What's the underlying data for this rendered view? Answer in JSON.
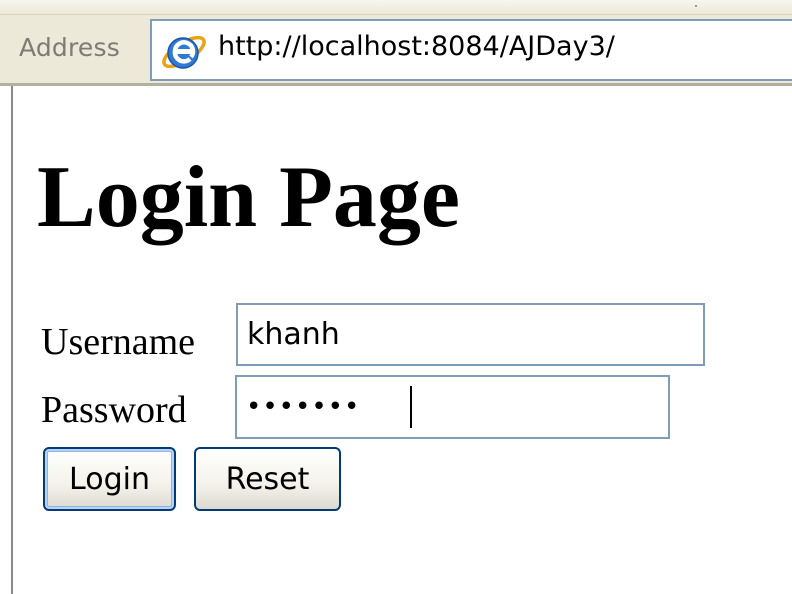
{
  "browser": {
    "address_label": "Address",
    "url": "http://localhost:8084/AJDay3/"
  },
  "page": {
    "title": "Login Page",
    "form": {
      "username_label": "Username",
      "username_value": "khanh",
      "password_label": "Password",
      "password_value": "khanhkk",
      "login_button": "Login",
      "reset_button": "Reset"
    }
  },
  "icons": {
    "ie_logo": "internet-explorer-icon"
  },
  "colors": {
    "input_border": "#7f9db9",
    "button_border": "#003c74",
    "chrome_background": "#ece9d8"
  }
}
